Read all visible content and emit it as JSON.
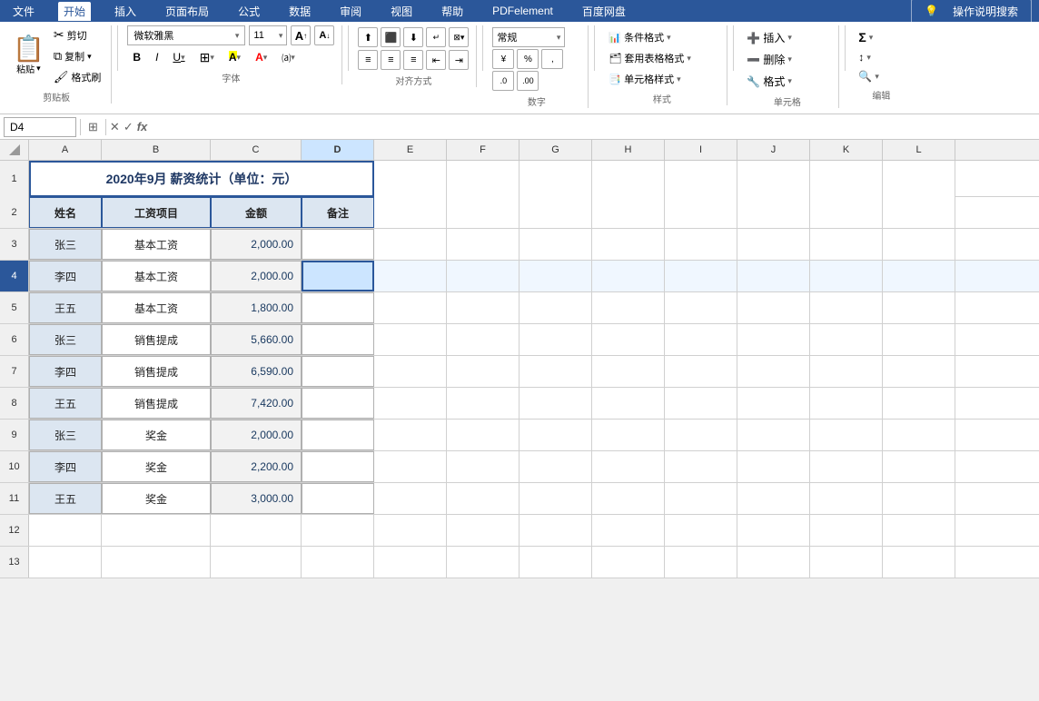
{
  "menu": {
    "tabs": [
      "文件",
      "开始",
      "插入",
      "页面布局",
      "公式",
      "数据",
      "审阅",
      "视图",
      "帮助",
      "PDFelement",
      "百度网盘"
    ],
    "active": "开始",
    "search_placeholder": "操作说明搜索"
  },
  "ribbon": {
    "clipboard": {
      "label": "剪贴板",
      "paste": "粘贴",
      "cut": "剪切",
      "copy": "复制",
      "format_painter": "格式刷"
    },
    "font": {
      "label": "字体",
      "font_name": "微软雅黑",
      "font_size": "11",
      "bold": "B",
      "italic": "I",
      "underline": "U",
      "increase": "A",
      "decrease": "A"
    },
    "alignment": {
      "label": "对齐方式"
    },
    "number": {
      "label": "数字",
      "format": "常规"
    },
    "styles": {
      "label": "样式",
      "conditional": "条件格式",
      "table": "套用表格格式",
      "cell": "单元格样式"
    },
    "cells": {
      "label": "单元格",
      "insert": "插入",
      "delete": "删除",
      "format": "格式"
    },
    "editing": {
      "label": "编辑"
    }
  },
  "formula_bar": {
    "cell_ref": "D4",
    "formula": ""
  },
  "spreadsheet": {
    "title": "2020年9月   薪资统计（单位：元）",
    "columns": [
      "A",
      "B",
      "C",
      "D",
      "E",
      "F",
      "G",
      "H",
      "I",
      "J",
      "K",
      "L"
    ],
    "headers": [
      "姓名",
      "工资项目",
      "金额",
      "备注"
    ],
    "rows": [
      {
        "row": 1,
        "a": "",
        "b": "",
        "c": "",
        "d": "",
        "is_title": true
      },
      {
        "row": 2,
        "a": "姓名",
        "b": "工资项目",
        "c": "金额",
        "d": "备注"
      },
      {
        "row": 3,
        "a": "张三",
        "b": "基本工资",
        "c": "2,000.00",
        "d": ""
      },
      {
        "row": 4,
        "a": "李四",
        "b": "基本工资",
        "c": "2,000.00",
        "d": ""
      },
      {
        "row": 5,
        "a": "王五",
        "b": "基本工资",
        "c": "1,800.00",
        "d": ""
      },
      {
        "row": 6,
        "a": "张三",
        "b": "销售提成",
        "c": "5,660.00",
        "d": ""
      },
      {
        "row": 7,
        "a": "李四",
        "b": "销售提成",
        "c": "6,590.00",
        "d": ""
      },
      {
        "row": 8,
        "a": "王五",
        "b": "销售提成",
        "c": "7,420.00",
        "d": ""
      },
      {
        "row": 9,
        "a": "张三",
        "b": "奖金",
        "c": "2,000.00",
        "d": ""
      },
      {
        "row": 10,
        "a": "李四",
        "b": "奖金",
        "c": "2,200.00",
        "d": ""
      },
      {
        "row": 11,
        "a": "王五",
        "b": "奖金",
        "c": "3,000.00",
        "d": ""
      },
      {
        "row": 12,
        "a": "",
        "b": "",
        "c": "",
        "d": ""
      },
      {
        "row": 13,
        "a": "",
        "b": "",
        "c": "",
        "d": ""
      }
    ]
  }
}
